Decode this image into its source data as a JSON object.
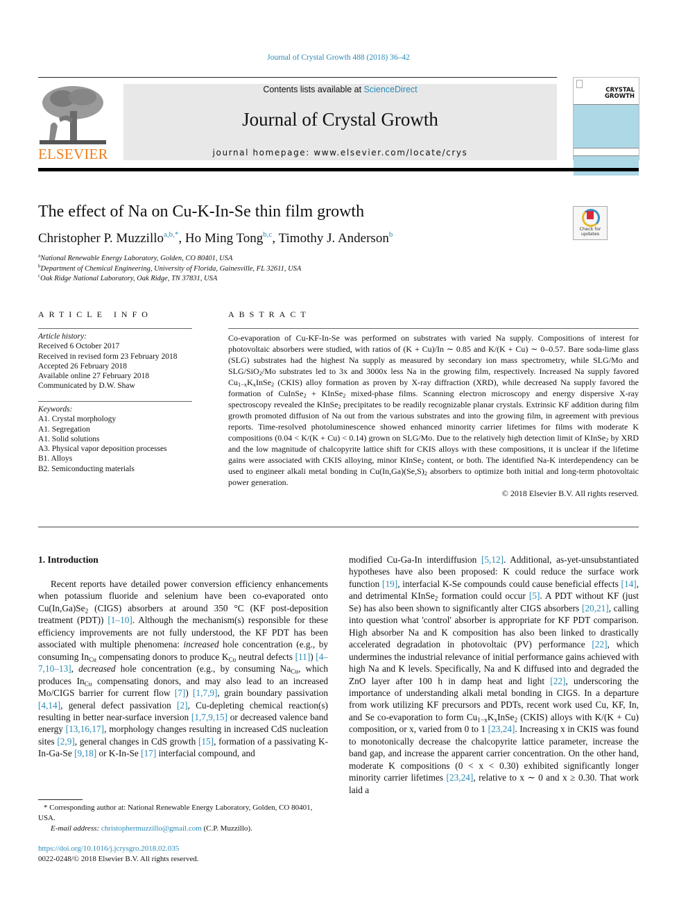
{
  "header": {
    "journal_ref": "Journal of Crystal Growth 488 (2018) 36–42",
    "publisher_logo_text": "ELSEVIER",
    "contents_prefix": "Contents lists available at ",
    "contents_link": "ScienceDirect",
    "journal_title": "Journal of Crystal Growth",
    "homepage": "journal homepage: www.elsevier.com/locate/crys",
    "cover_line1": "CRYSTAL",
    "cover_line2": "GROWTH",
    "check_updates_line1": "Check for",
    "check_updates_line2": "updates"
  },
  "article": {
    "title": "The effect of Na on Cu-K-In-Se thin film growth",
    "authors": [
      {
        "name": "Christopher P. Muzzillo",
        "sup": "a,b,*",
        "sep": ", "
      },
      {
        "name": "Ho Ming Tong",
        "sup": "b,c",
        "sep": ", "
      },
      {
        "name": "Timothy J. Anderson",
        "sup": "b",
        "sep": ""
      }
    ],
    "affiliations": [
      {
        "mark": "a",
        "text": "National Renewable Energy Laboratory, Golden, CO 80401, USA"
      },
      {
        "mark": "b",
        "text": "Department of Chemical Engineering, University of Florida, Gainesville, FL 32611, USA"
      },
      {
        "mark": "c",
        "text": "Oak Ridge National Laboratory, Oak Ridge, TN 37831, USA"
      }
    ]
  },
  "article_info": {
    "heading": "ARTICLE INFO",
    "history_label": "Article history:",
    "history": [
      "Received 6 October 2017",
      "Received in revised form 23 February 2018",
      "Accepted 26 February 2018",
      "Available online 27 February 2018",
      "Communicated by D.W. Shaw"
    ],
    "keywords_label": "Keywords:",
    "keywords": [
      "A1. Crystal morphology",
      "A1. Segregation",
      "A1. Solid solutions",
      "A3. Physical vapor deposition processes",
      "B1. Alloys",
      "B2. Semiconducting materials"
    ]
  },
  "abstract": {
    "heading": "ABSTRACT",
    "p1": "Co-evaporation of Cu-KF-In-Se was performed on substrates with varied Na supply. Compositions of interest for photovoltaic absorbers were studied, with ratios of (K + Cu)/In ∼ 0.85 and K/(K + Cu) ∼ 0–0.57. Bare soda-lime glass (SLG) substrates had the highest Na supply as measured by secondary ion mass spectrometry, while SLG/Mo and SLG/SiO",
    "p2": "/Mo substrates led to 3x and 3000x less Na in the growing film, respectively. Increased Na supply favored Cu",
    "p3": "K",
    "p4": "InSe",
    "p5": " (CKIS) alloy formation as proven by X-ray diffraction (XRD), while decreased Na supply favored the formation of CuInSe",
    "p6": " + KInSe",
    "p7": " mixed-phase films. Scanning electron microscopy and energy dispersive X-ray spectroscopy revealed the KInSe",
    "p8": " precipitates to be readily recognizable planar crystals. Extrinsic KF addition during film growth promoted diffusion of Na out from the various substrates and into the growing film, in agreement with previous reports. Time-resolved photoluminescence showed enhanced minority carrier lifetimes for films with moderate K compositions (0.04 < K/(K + Cu) < 0.14) grown on SLG/Mo. Due to the relatively high detection limit of KInSe",
    "p9": " by XRD and the low magnitude of chalcopyrite lattice shift for CKIS alloys with these compositions, it is unclear if the lifetime gains were associated with CKIS alloying, minor KInSe",
    "p10": " content, or both. The identified Na-K interdependency can be used to engineer alkali metal bonding in Cu(In,Ga)(Se,S)",
    "p11": " absorbers to optimize both initial and long-term photovoltaic power generation.",
    "sub2": "2",
    "sub_1mx": "1−x",
    "sub_x": "x",
    "copyright": "© 2018 Elsevier B.V. All rights reserved."
  },
  "intro": {
    "heading": "1. Introduction",
    "left": {
      "t1": "Recent reports have detailed power conversion efficiency enhancements when potassium fluoride and selenium have been co-evaporated onto Cu(In,Ga)Se",
      "t2": " (CIGS) absorbers at around 350 °C (KF post-deposition treatment (PDT)) ",
      "c1": "[1–10]",
      "t3": ". Although the mechanism(s) responsible for these efficiency improvements are not fully understood, the KF PDT has been associated with multiple phenomena: ",
      "em1": "increased",
      "t4": " hole concentration (e.g., by consuming In",
      "subCu": "Cu",
      "t5": " compensating donors to produce K",
      "t6": " neutral defects ",
      "c2": "[11]",
      "t7": ") ",
      "c3": "[4–7,10–13]",
      "t8": ", ",
      "em2": "decreased",
      "t9": " hole concentration (e.g., by consuming Na",
      "t10": ", which produces In",
      "t11": " compensating donors, and may also lead to an increased Mo/CIGS barrier for current flow ",
      "c4": "[7]",
      "t12": ") ",
      "c5": "[1,7,9]",
      "t13": ", grain boundary passivation ",
      "c6": "[4,14]",
      "t14": ", general defect passivation ",
      "c7": "[2]",
      "t15": ", Cu-depleting chemical reaction(s) resulting in better near-surface inversion ",
      "c8": "[1,7,9,15]",
      "t16": " or decreased valence band energy ",
      "c9": "[13,16,17]",
      "t17": ", morphology changes resulting in increased CdS nucleation sites ",
      "c10": "[2,9]",
      "t18": ", general changes in CdS growth ",
      "c11": "[15]",
      "t19": ", formation of a passivating K-In-Ga-Se ",
      "c12": "[9,18]",
      "t20": " or K-In-Se ",
      "c13": "[17]",
      "t21": " interfacial compound, and"
    },
    "right": {
      "t1": "modified Cu-Ga-In interdiffusion ",
      "c1": "[5,12]",
      "t2": ". Additional, as-yet-unsubstantiated hypotheses have also been proposed: K could reduce the surface work function ",
      "c2": "[19]",
      "t3": ", interfacial K-Se compounds could cause beneficial effects ",
      "c3": "[14]",
      "t4": ", and detrimental KInSe",
      "t5": " formation could occur ",
      "c4": "[5]",
      "t6": ". A PDT without KF (just Se) has also been shown to significantly alter CIGS absorbers ",
      "c5": "[20,21]",
      "t7": ", calling into question what 'control' absorber is appropriate for KF PDT comparison. High absorber Na and K composition has also been linked to drastically accelerated degradation in photovoltaic (PV) performance ",
      "c6": "[22]",
      "t8": ", which undermines the industrial relevance of initial performance gains achieved with high Na and K levels. Specifically, Na and K diffused into and degraded the ZnO layer after 100 h in damp heat and light ",
      "c7": "[22]",
      "t9": ", underscoring the importance of understanding alkali metal bonding in CIGS. In a departure from work utilizing KF precursors and PDTs, recent work used Cu, KF, In, and Se co-evaporation to form Cu",
      "t10": "K",
      "t11": "InSe",
      "t12": " (CKIS) alloys with K/(K + Cu) composition, or x, varied from 0 to 1 ",
      "c8": "[23,24]",
      "t13": ". Increasing x in CKIS was found to monotonically decrease the chalcopyrite lattice parameter, increase the band gap, and increase the apparent carrier concentration. On the other hand, moderate K compositions (0 < x < 0.30) exhibited significantly longer minority carrier lifetimes ",
      "c9": "[23,24]",
      "t14": ", relative to x ∼ 0 and x ≥ 0.30. That work laid a"
    }
  },
  "footnote": {
    "corresponding": "* Corresponding author at: National Renewable Energy Laboratory, Golden, CO 80401, USA.",
    "email_label": "E-mail address: ",
    "email": "christophermuzzillo@gmail.com",
    "email_suffix": " (C.P. Muzzillo)."
  },
  "doi": {
    "link": "https://doi.org/10.1016/j.jcrysgro.2018.02.035",
    "issn": "0022-0248/© 2018 Elsevier B.V. All rights reserved."
  }
}
